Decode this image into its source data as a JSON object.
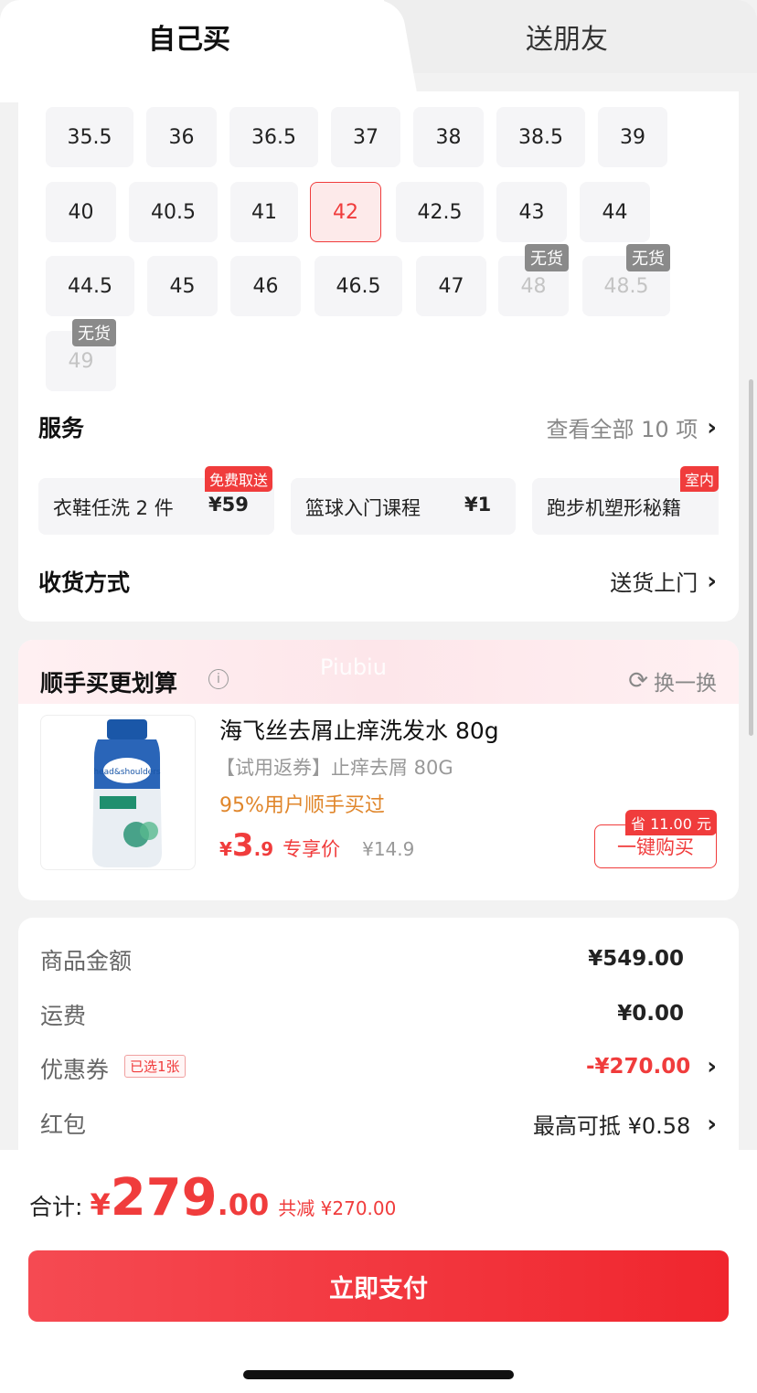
{
  "tabs": {
    "self_buy": "自己买",
    "gift": "送朋友"
  },
  "sizes": [
    {
      "label": "35.5",
      "state": "normal"
    },
    {
      "label": "36",
      "state": "normal"
    },
    {
      "label": "36.5",
      "state": "normal"
    },
    {
      "label": "37",
      "state": "normal"
    },
    {
      "label": "38",
      "state": "normal"
    },
    {
      "label": "38.5",
      "state": "normal"
    },
    {
      "label": "39",
      "state": "normal"
    },
    {
      "label": "40",
      "state": "normal"
    },
    {
      "label": "40.5",
      "state": "normal"
    },
    {
      "label": "41",
      "state": "normal"
    },
    {
      "label": "42",
      "state": "selected"
    },
    {
      "label": "42.5",
      "state": "normal"
    },
    {
      "label": "43",
      "state": "normal"
    },
    {
      "label": "44",
      "state": "normal"
    },
    {
      "label": "44.5",
      "state": "normal"
    },
    {
      "label": "45",
      "state": "normal"
    },
    {
      "label": "46",
      "state": "normal"
    },
    {
      "label": "46.5",
      "state": "normal"
    },
    {
      "label": "47",
      "state": "normal"
    },
    {
      "label": "48",
      "state": "out_of_stock"
    },
    {
      "label": "48.5",
      "state": "out_of_stock"
    },
    {
      "label": "49",
      "state": "out_of_stock"
    }
  ],
  "out_of_stock_label": "无货",
  "services": {
    "title": "服务",
    "view_all": "查看全部 10 项",
    "items": [
      {
        "name": "衣鞋任洗 2 件",
        "price": "¥59",
        "badge": "免费取送"
      },
      {
        "name": "篮球入门课程",
        "price": "¥1",
        "badge": ""
      },
      {
        "name": "跑步机塑形秘籍",
        "price": "",
        "badge": "室内"
      }
    ]
  },
  "delivery": {
    "title": "收货方式",
    "value": "送货上门"
  },
  "addon": {
    "title": "顺手买更划算",
    "watermark": "Piubiu",
    "swap": "换一换",
    "product": {
      "title": "海飞丝去屑止痒洗发水 80g",
      "subtitle": "【试用返券】止痒去屑 80G",
      "users": "95%用户顺手买过",
      "price_currency": "¥",
      "price_int": "3",
      "price_dec": ".9",
      "price_tag": "专享价",
      "original_price": "¥14.9",
      "save_badge": "省 11.00 元",
      "buy_label": "一键购买"
    }
  },
  "summary": {
    "goods_label": "商品金额",
    "goods_value": "¥549.00",
    "shipping_label": "运费",
    "shipping_value": "¥0.00",
    "coupon_label": "优惠券",
    "coupon_tag": "已选1张",
    "coupon_value": "-¥270.00",
    "redpacket_label": "红包",
    "redpacket_value": "最高可抵 ¥0.58"
  },
  "total": {
    "label": "合计:",
    "currency": "¥",
    "int": "279",
    "dec": ".00",
    "saved": "共减 ¥270.00"
  },
  "pay_button": "立即支付",
  "colors": {
    "accent": "#f03c3c",
    "orange": "#e0862b"
  }
}
